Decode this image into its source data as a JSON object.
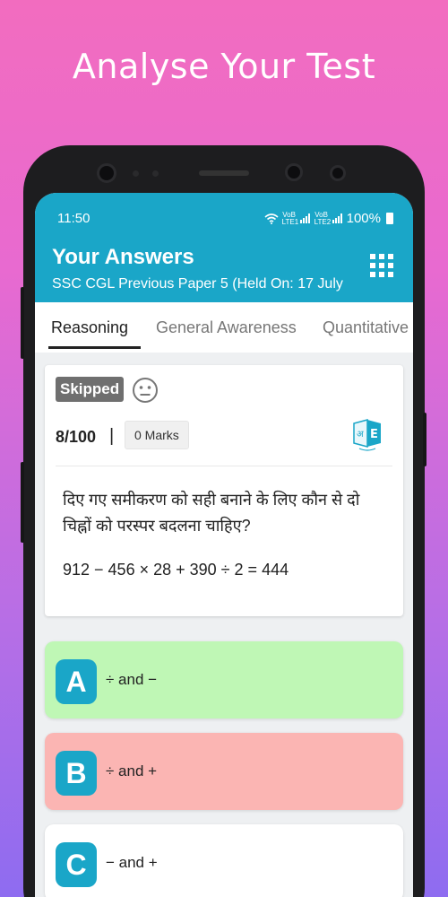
{
  "promo": {
    "title": "Analyse Your Test"
  },
  "status_bar": {
    "time": "11:50",
    "network1": "VoB LTE1",
    "network2": "VoB LTE2",
    "battery": "100%"
  },
  "header": {
    "title": "Your Answers",
    "subtitle": "SSC CGL Previous Paper 5 (Held On: 17 July"
  },
  "tabs": [
    {
      "label": "Reasoning",
      "active": true
    },
    {
      "label": "General Awareness",
      "active": false
    },
    {
      "label": "Quantitative",
      "active": false
    }
  ],
  "question": {
    "status": "Skipped",
    "number": "8/100",
    "separator": "|",
    "marks": "0 Marks",
    "text": "दिए गए समीकरण को सही बनाने के लिए कौन से दो चिह्नों को परस्पर बदलना चाहिए?",
    "equation": "912 − 456 × 28 + 390 ÷ 2 = 444"
  },
  "options": [
    {
      "letter": "A",
      "text": "÷ and −",
      "state": "correct",
      "color": "#bff7b5"
    },
    {
      "letter": "B",
      "text": "÷ and +",
      "state": "wrong",
      "color": "#fbb5b3"
    },
    {
      "letter": "C",
      "text": "− and +",
      "state": "neutral",
      "color": "#ffffff"
    }
  ],
  "colors": {
    "accent": "#1aa6c8",
    "skipped_badge": "#6f6f6f"
  }
}
